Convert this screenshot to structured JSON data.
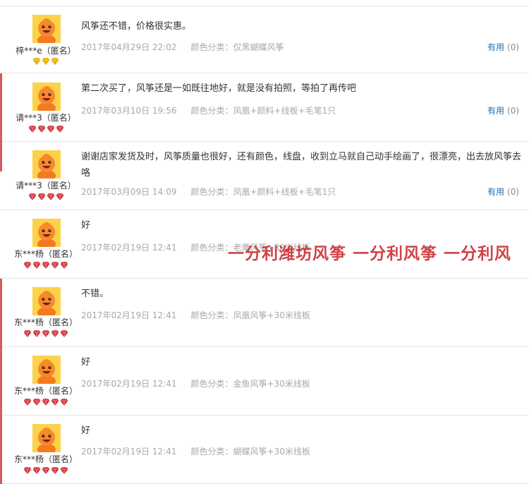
{
  "colors": {
    "accent_link": "#1d6eb3",
    "meta_grey": "#a8a8a8",
    "watermark_red": "#c9282d",
    "badge_gold": "#f2b705",
    "badge_red": "#d8323a"
  },
  "watermark": "一分利潍坊风筝 一分利风筝 一分利风",
  "reviews": [
    {
      "nickname": "梓***e（匿名）",
      "content": "风筝还不错，价格很实惠。",
      "datetime": "2017年04月29日 22:02",
      "sku_label": "颜色分类：",
      "sku": "仅黑蝴蝶风筝",
      "useful_label": "有用",
      "useful_count": "(0)",
      "badge_type": "gold",
      "badge_count": 3,
      "avatar_icon": "default-user-avatar-icon"
    },
    {
      "nickname": "请***3（匿名）",
      "content": "第二次买了，风筝还是一如既往地好，就是没有拍照，等拍了再传吧",
      "datetime": "2017年03月10日 19:56",
      "sku_label": "颜色分类：",
      "sku": "凤凰+颜料+线板+毛笔1只",
      "useful_label": "有用",
      "useful_count": "(0)",
      "badge_type": "red",
      "badge_count": 4,
      "avatar_icon": "default-user-avatar-icon"
    },
    {
      "nickname": "请***3（匿名）",
      "content": "谢谢店家发货及时，风筝质量也很好，还有颜色，线盘，收到立马就自己动手绘画了，很漂亮，出去放风筝去咯",
      "datetime": "2017年03月09日 14:09",
      "sku_label": "颜色分类：",
      "sku": "凤凰+颜料+线板+毛笔1只",
      "useful_label": "有用",
      "useful_count": "(0)",
      "badge_type": "red",
      "badge_count": 4,
      "avatar_icon": "default-user-avatar-icon"
    },
    {
      "nickname": "东***杨（匿名）",
      "content": "好",
      "datetime": "2017年02月19日 12:41",
      "sku_label": "颜色分类：",
      "sku": "老鹰风筝+30米线板",
      "useful_label": "",
      "useful_count": "",
      "badge_type": "red",
      "badge_count": 5,
      "avatar_icon": "default-user-avatar-icon"
    },
    {
      "nickname": "东***杨（匿名）",
      "content": "不错。",
      "datetime": "2017年02月19日 12:41",
      "sku_label": "颜色分类：",
      "sku": "凤凰风筝+30米线板",
      "useful_label": "",
      "useful_count": "",
      "badge_type": "red",
      "badge_count": 5,
      "avatar_icon": "default-user-avatar-icon"
    },
    {
      "nickname": "东***杨（匿名）",
      "content": "好",
      "datetime": "2017年02月19日 12:41",
      "sku_label": "颜色分类：",
      "sku": "金鱼风筝+30米线板",
      "useful_label": "",
      "useful_count": "",
      "badge_type": "red",
      "badge_count": 5,
      "avatar_icon": "default-user-avatar-icon"
    },
    {
      "nickname": "东***杨（匿名）",
      "content": "好",
      "datetime": "2017年02月19日 12:41",
      "sku_label": "颜色分类：",
      "sku": "蝴蝶风筝+30米线板",
      "useful_label": "",
      "useful_count": "",
      "badge_type": "red",
      "badge_count": 5,
      "avatar_icon": "default-user-avatar-icon"
    }
  ]
}
